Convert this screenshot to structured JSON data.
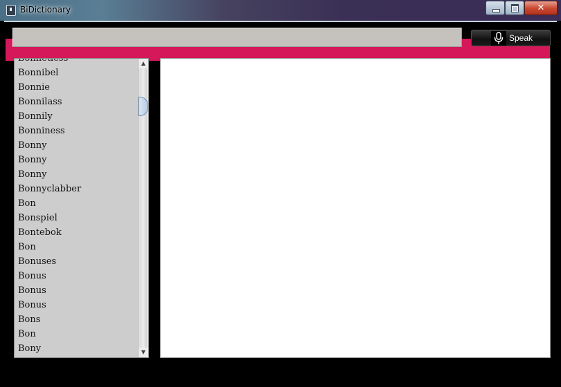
{
  "window": {
    "title": "BiDictionary",
    "close_glyph": "✕",
    "app_icon": "app-book-icon"
  },
  "toolbar": {
    "search_value": "",
    "speak_label": "Speak",
    "speak_icon": "microphone-icon",
    "accent_color": "#d4185a"
  },
  "word_list": {
    "items": [
      "Bonnetless",
      "Bonnibel",
      "Bonnie",
      "Bonnilass",
      "Bonnily",
      "Bonniness",
      "Bonny",
      "Bonny",
      "Bonny",
      "Bonnyclabber",
      "Bon",
      "Bonspiel",
      "Bontebok",
      "Bon",
      "Bonuses",
      "Bonus",
      "Bonus",
      "Bonus",
      "Bons",
      "Bon",
      "Bony"
    ]
  },
  "definition": {
    "text": ""
  }
}
